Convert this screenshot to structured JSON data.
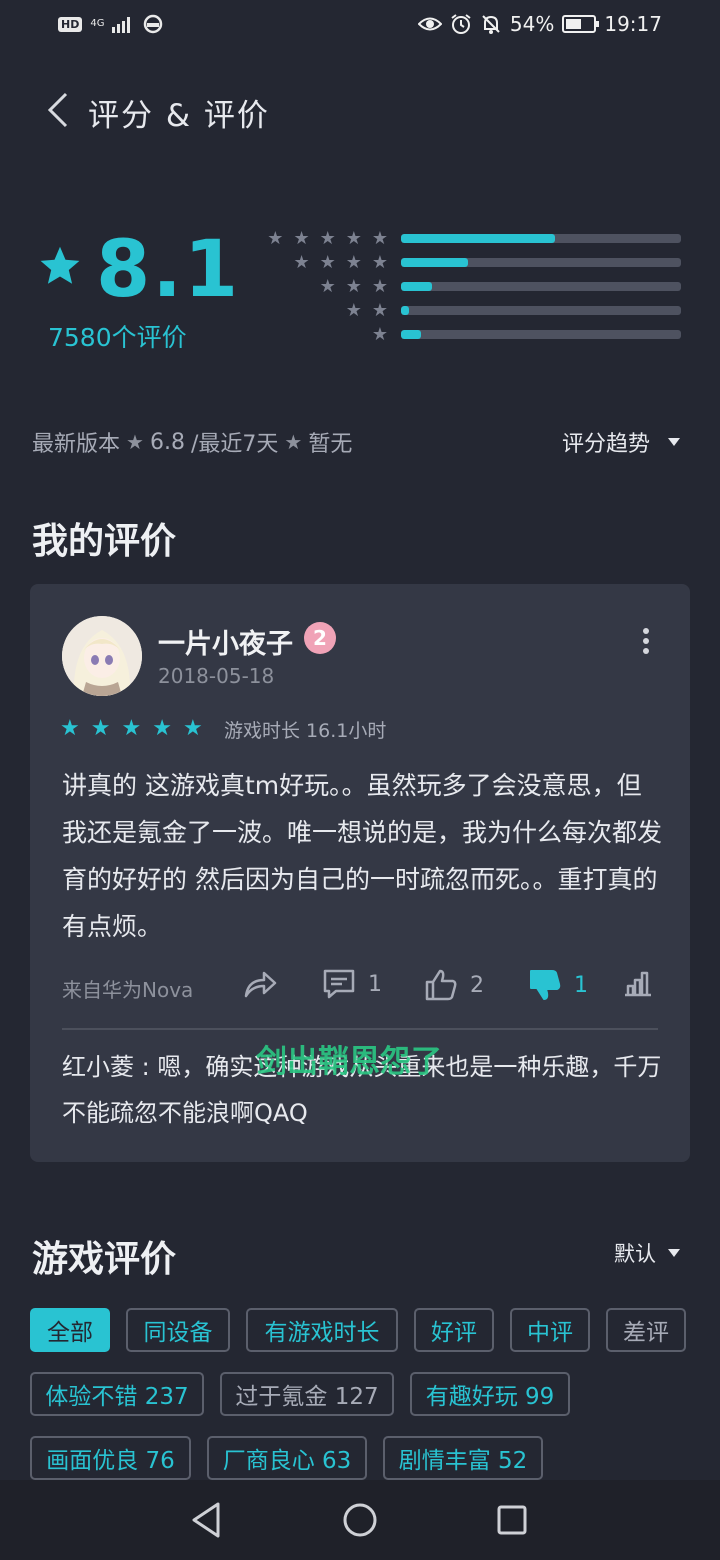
{
  "status_bar": {
    "network_hd": "HD",
    "network_gen": "4G",
    "battery": "54%",
    "time": "19:17"
  },
  "header": {
    "title": "评分 & 评价"
  },
  "rating": {
    "score": "8.1",
    "review_count": "7580个评价",
    "distribution": [
      {
        "stars": 5,
        "fraction": 0.55
      },
      {
        "stars": 4,
        "fraction": 0.24
      },
      {
        "stars": 3,
        "fraction": 0.11
      },
      {
        "stars": 2,
        "fraction": 0.03
      },
      {
        "stars": 1,
        "fraction": 0.07
      }
    ],
    "latest_version_label": "最新版本",
    "latest_version_score": "6.8",
    "recent_label": "/最近7天",
    "recent_value": "暂无",
    "trend_label": "评分趋势"
  },
  "my_review": {
    "section_title": "我的评价",
    "user_name": "一片小夜子",
    "level": "2",
    "date": "2018-05-18",
    "rating_stars": 5,
    "playtime": "游戏时长 16.1小时",
    "text": "讲真的 这游戏真tm好玩。。虽然玩多了会没意思，但我还是氪金了一波。唯一想说的是，我为什么每次都发育的好好的 然后因为自己的一时疏忽而死。。重打真的有点烦。",
    "device": "来自华为Nova",
    "comment_count": "1",
    "like_count": "2",
    "dislike_count": "1",
    "reply": "红小菱 : 嗯，确实这种游戏从头重来也是一种乐趣，千万不能疏忽不能浪啊QAQ",
    "watermark": "剑出鞘恩怨了"
  },
  "game_reviews": {
    "section_title": "游戏评价",
    "sort_label": "默认",
    "filters": [
      "全部",
      "同设备",
      "有游戏时长",
      "好评",
      "中评",
      "差评"
    ],
    "tags": [
      "体验不错 237",
      "过于氪金 127",
      "有趣好玩 99",
      "画面优良 76",
      "厂商良心 63",
      "剧情丰富 52"
    ]
  },
  "colors": {
    "accent": "#29c3d2",
    "background": "#242732",
    "card": "#343845"
  }
}
